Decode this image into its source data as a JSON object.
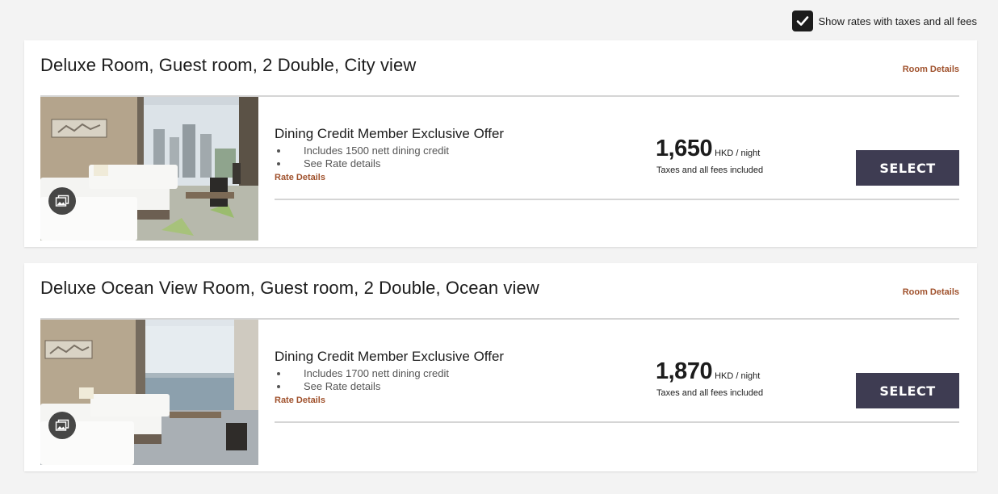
{
  "settings": {
    "show_taxes_label": "Show rates with taxes and all fees",
    "show_taxes_checked": true
  },
  "rooms": [
    {
      "title": "Deluxe Room, Guest room, 2 Double, City view",
      "room_details_label": "Room Details",
      "offer": {
        "title": "Dining Credit Member Exclusive Offer",
        "bullets": [
          "Includes 1500 nett dining credit",
          "See Rate details"
        ],
        "rate_details_label": "Rate Details"
      },
      "price": {
        "amount": "1,650",
        "unit": "HKD / night",
        "note": "Taxes and all fees included"
      },
      "select_label": "SELECT"
    },
    {
      "title": "Deluxe Ocean View Room, Guest room, 2 Double, Ocean view",
      "room_details_label": "Room Details",
      "offer": {
        "title": "Dining Credit Member Exclusive Offer",
        "bullets": [
          "Includes 1700 nett dining credit",
          "See Rate details"
        ],
        "rate_details_label": "Rate Details"
      },
      "price": {
        "amount": "1,870",
        "unit": "HKD / night",
        "note": "Taxes and all fees included"
      },
      "select_label": "SELECT"
    }
  ],
  "colors": {
    "accent_link": "#a0522d",
    "select_button": "#3e3c52",
    "page_background": "#f3f3f3"
  },
  "icons": {
    "checkbox": "checkmark-icon",
    "gallery": "gallery-icon"
  }
}
